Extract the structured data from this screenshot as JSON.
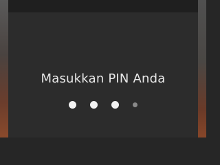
{
  "lockscreen": {
    "prompt": "Masukkan PIN Anda",
    "pin_length": 4,
    "pin_entered": 3,
    "dot_colors": {
      "filled": "#f2f2f2",
      "empty": "#8a8a8a"
    }
  }
}
